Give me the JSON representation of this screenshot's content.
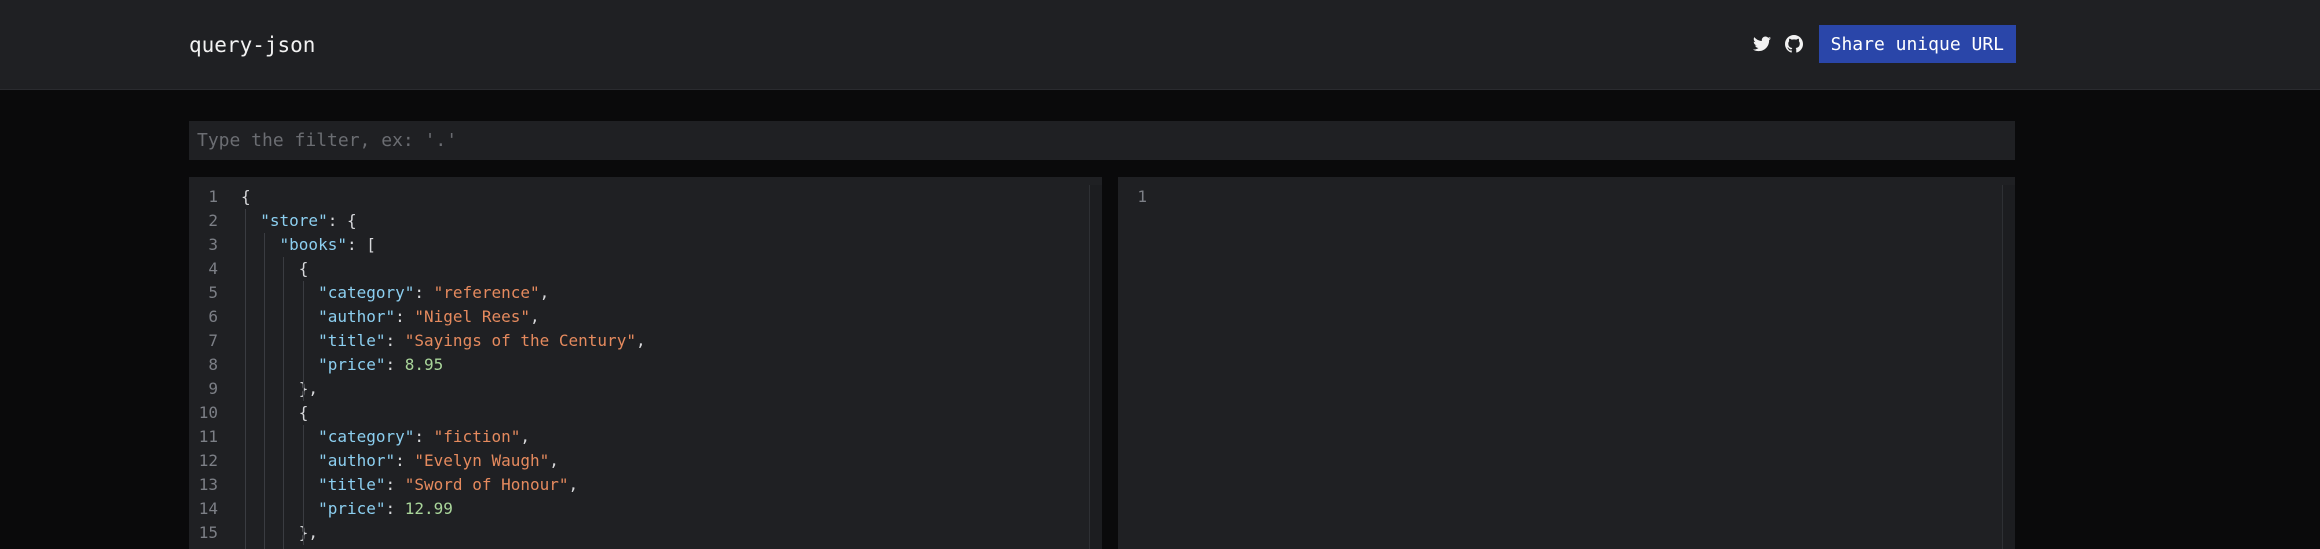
{
  "header": {
    "title": "query-json",
    "twitter_icon": "twitter-icon",
    "github_icon": "github-icon",
    "share_label": "Share unique URL",
    "accent": "#2a46a9"
  },
  "filter": {
    "placeholder": "Type the filter, ex: '.'",
    "value": ""
  },
  "input_editor": {
    "lines": [
      {
        "n": "1",
        "tokens": [
          [
            "pun",
            "{"
          ]
        ]
      },
      {
        "n": "2",
        "tokens": [
          [
            "pun",
            "  "
          ],
          [
            "key",
            "\"store\""
          ],
          [
            "pun",
            ": {"
          ]
        ]
      },
      {
        "n": "3",
        "tokens": [
          [
            "pun",
            "    "
          ],
          [
            "key",
            "\"books\""
          ],
          [
            "pun",
            ": ["
          ]
        ]
      },
      {
        "n": "4",
        "tokens": [
          [
            "pun",
            "      {"
          ]
        ]
      },
      {
        "n": "5",
        "tokens": [
          [
            "pun",
            "        "
          ],
          [
            "key",
            "\"category\""
          ],
          [
            "pun",
            ": "
          ],
          [
            "str",
            "\"reference\""
          ],
          [
            "pun",
            ","
          ]
        ]
      },
      {
        "n": "6",
        "tokens": [
          [
            "pun",
            "        "
          ],
          [
            "key",
            "\"author\""
          ],
          [
            "pun",
            ": "
          ],
          [
            "str",
            "\"Nigel Rees\""
          ],
          [
            "pun",
            ","
          ]
        ]
      },
      {
        "n": "7",
        "tokens": [
          [
            "pun",
            "        "
          ],
          [
            "key",
            "\"title\""
          ],
          [
            "pun",
            ": "
          ],
          [
            "str",
            "\"Sayings of the Century\""
          ],
          [
            "pun",
            ","
          ]
        ]
      },
      {
        "n": "8",
        "tokens": [
          [
            "pun",
            "        "
          ],
          [
            "key",
            "\"price\""
          ],
          [
            "pun",
            ": "
          ],
          [
            "num",
            "8.95"
          ]
        ]
      },
      {
        "n": "9",
        "tokens": [
          [
            "pun",
            "      },"
          ]
        ]
      },
      {
        "n": "10",
        "tokens": [
          [
            "pun",
            "      {"
          ]
        ]
      },
      {
        "n": "11",
        "tokens": [
          [
            "pun",
            "        "
          ],
          [
            "key",
            "\"category\""
          ],
          [
            "pun",
            ": "
          ],
          [
            "str",
            "\"fiction\""
          ],
          [
            "pun",
            ","
          ]
        ]
      },
      {
        "n": "12",
        "tokens": [
          [
            "pun",
            "        "
          ],
          [
            "key",
            "\"author\""
          ],
          [
            "pun",
            ": "
          ],
          [
            "str",
            "\"Evelyn Waugh\""
          ],
          [
            "pun",
            ","
          ]
        ]
      },
      {
        "n": "13",
        "tokens": [
          [
            "pun",
            "        "
          ],
          [
            "key",
            "\"title\""
          ],
          [
            "pun",
            ": "
          ],
          [
            "str",
            "\"Sword of Honour\""
          ],
          [
            "pun",
            ","
          ]
        ]
      },
      {
        "n": "14",
        "tokens": [
          [
            "pun",
            "        "
          ],
          [
            "key",
            "\"price\""
          ],
          [
            "pun",
            ": "
          ],
          [
            "num",
            "12.99"
          ]
        ]
      },
      {
        "n": "15",
        "tokens": [
          [
            "pun",
            "      },"
          ]
        ]
      }
    ]
  },
  "output_editor": {
    "lines": [
      {
        "n": "1",
        "tokens": []
      }
    ]
  }
}
